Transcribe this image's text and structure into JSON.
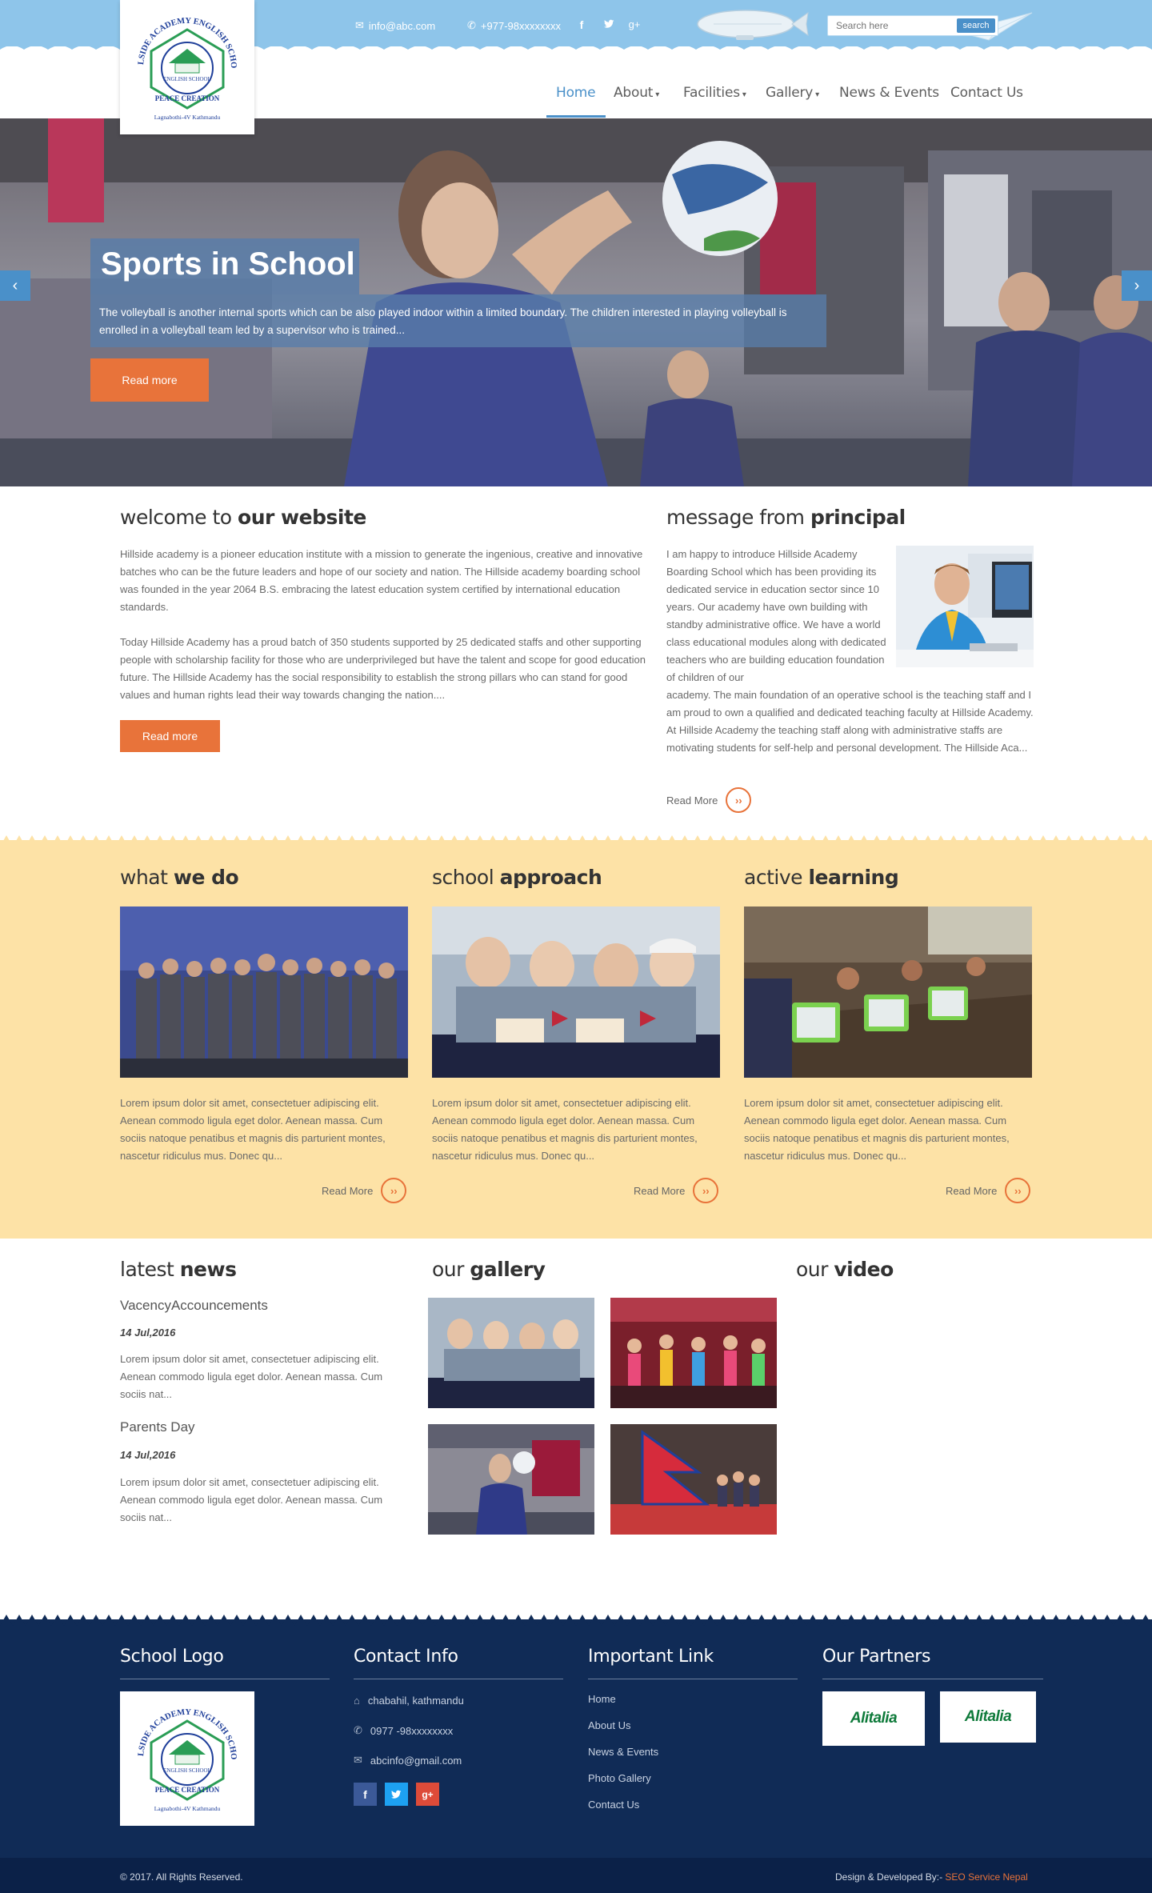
{
  "header": {
    "email": "info@abc.com",
    "phone": "+977-98xxxxxxxx",
    "search_placeholder": "Search here",
    "search_button": "search"
  },
  "logo": {
    "arc_text": "HILLSIDE ACADEMY ENGLISH SCHOOL",
    "center_text": "ENGLISH SCHOOL",
    "estd": "ESTD",
    "motto": "PEACE CREATION",
    "location": "Lagnabothi-4V Kathmandu"
  },
  "nav": {
    "items": [
      {
        "label": "Home",
        "active": true
      },
      {
        "label": "About",
        "dropdown": true
      },
      {
        "label": "Facilities",
        "dropdown": true
      },
      {
        "label": "Gallery",
        "dropdown": true
      },
      {
        "label": "News & Events"
      },
      {
        "label": "Contact Us"
      }
    ]
  },
  "slider": {
    "title": "Sports in School",
    "description": "The volleyball is another internal sports which can be also played indoor within a limited boundary. The children interested in playing volleyball is enrolled in a volleyball team led by a supervisor who is trained...",
    "button": "Read more"
  },
  "welcome": {
    "heading_light": "welcome to ",
    "heading_bold": "our website",
    "para1": "Hillside academy is a pioneer education institute with a mission to generate the ingenious, creative and innovative batches who can be the future leaders and hope of our society and nation. The Hillside academy boarding school was founded in the year 2064 B.S. embracing the latest education system certified by international education standards.",
    "para2": "Today Hillside Academy has a proud batch of 350 students supported by 25 dedicated staffs and other supporting people with scholarship facility for those who are underprivileged but have the talent and scope for good education future. The Hillside Academy has the social responsibility to establish the strong pillars who can stand for good values and human rights lead their way towards changing the nation....",
    "button": "Read more"
  },
  "principal": {
    "heading_light": "message from ",
    "heading_bold": "principal",
    "text_wrap": "I am happy to introduce Hillside Academy Boarding School which has been providing its dedicated service in education sector since 10 years. Our academy have own building with standby administrative office. We have a world class educational modules along with dedicated teachers who are building education foundation of children of our",
    "text_full": "academy. The main foundation of an operative school is the teaching staff and I am proud to own a qualified and dedicated teaching faculty at Hillside Academy. At Hillside Academy the teaching staff along with administrative staffs are motivating students for self-help and personal development. The Hillside Aca...",
    "read_more": "Read More"
  },
  "features": [
    {
      "heading_light": "what ",
      "heading_bold": "we do",
      "text": "Lorem ipsum dolor sit amet, consectetuer adipiscing elit. Aenean commodo ligula eget dolor. Aenean massa. Cum sociis natoque penatibus et magnis dis parturient montes, nascetur ridiculus mus. Donec qu...",
      "read_more": "Read More"
    },
    {
      "heading_light": "school ",
      "heading_bold": "approach",
      "text": "Lorem ipsum dolor sit amet, consectetuer adipiscing elit. Aenean commodo ligula eget dolor. Aenean massa. Cum sociis natoque penatibus et magnis dis parturient montes, nascetur ridiculus mus. Donec qu...",
      "read_more": "Read More"
    },
    {
      "heading_light": "active ",
      "heading_bold": "learning",
      "text": "Lorem ipsum dolor sit amet, consectetuer adipiscing elit. Aenean commodo ligula eget dolor. Aenean massa. Cum sociis natoque penatibus et magnis dis parturient montes, nascetur ridiculus mus. Donec qu...",
      "read_more": "Read More"
    }
  ],
  "news": {
    "heading_light": "latest ",
    "heading_bold": "news",
    "items": [
      {
        "title": "VacencyAccouncements",
        "date": "14 Jul,2016",
        "text": "Lorem ipsum dolor sit amet, consectetuer adipiscing elit. Aenean commodo ligula eget dolor. Aenean massa. Cum sociis nat..."
      },
      {
        "title": "Parents Day",
        "date": "14 Jul,2016",
        "text": "Lorem ipsum dolor sit amet, consectetuer adipiscing elit. Aenean commodo ligula eget dolor. Aenean massa. Cum sociis nat..."
      }
    ]
  },
  "gallery": {
    "heading_light": "our ",
    "heading_bold": "gallery"
  },
  "video": {
    "heading_light": "our ",
    "heading_bold": "video"
  },
  "footer": {
    "logo_heading": "School Logo",
    "contact_heading": "Contact Info",
    "address": "chabahil, kathmandu",
    "phone": "0977 -98xxxxxxxx",
    "email": "abcinfo@gmail.com",
    "links_heading": "Important Link",
    "links": [
      "Home",
      "About Us",
      "News & Events",
      "Photo Gallery",
      "Contact Us"
    ],
    "partners_heading": "Our Partners",
    "partners": [
      "Alitalia",
      "Alitalia"
    ],
    "copyright": "© 2017. All Rights Reserved.",
    "credit_label": "Design & Developed By:-",
    "credit_name": "SEO Service Nepal"
  },
  "colors": {
    "sky": "#8ec5ea",
    "accent_blue": "#4a90c9",
    "orange": "#e8733a",
    "band_yellow": "#fde2a6",
    "footer_navy": "#102b56"
  }
}
